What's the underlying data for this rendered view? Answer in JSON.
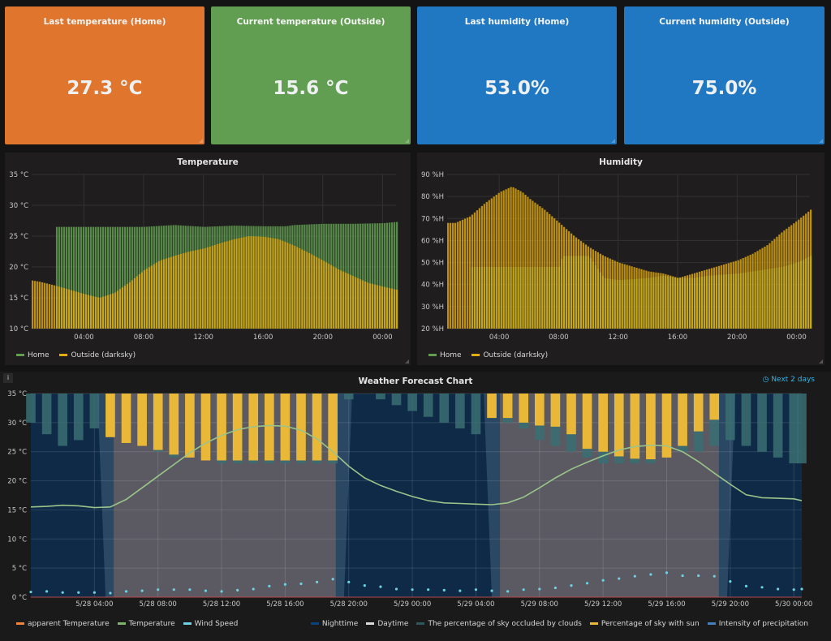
{
  "stats": [
    {
      "title": "Last temperature (Home)",
      "value": "27.3 °C",
      "color": "#e0752d"
    },
    {
      "title": "Current temperature (Outside)",
      "value": "15.6 °C",
      "color": "#629e51"
    },
    {
      "title": "Last humidity (Home)",
      "value": "53.0%",
      "color": "#1f78c1"
    },
    {
      "title": "Current humidity (Outside)",
      "value": "75.0%",
      "color": "#1f78c1"
    }
  ],
  "temperature_panel": {
    "title": "Temperature",
    "legend": [
      {
        "label": "Home",
        "color": "#629e51"
      },
      {
        "label": "Outside (darksky)",
        "color": "#e5ac0e"
      }
    ]
  },
  "humidity_panel": {
    "title": "Humidity",
    "legend": [
      {
        "label": "Home",
        "color": "#629e51"
      },
      {
        "label": "Outside (darksky)",
        "color": "#e5ac0e"
      }
    ]
  },
  "forecast_panel": {
    "title": "Weather Forecast Chart",
    "time_range": "Next 2 days",
    "legend_left": [
      {
        "label": "apparent Temperature",
        "color": "#ef843c"
      },
      {
        "label": "Temperature",
        "color": "#7eb26d"
      },
      {
        "label": "Wind Speed",
        "color": "#6ed0e0"
      }
    ],
    "legend_right": [
      {
        "label": "Nighttime",
        "color": "#0a437c"
      },
      {
        "label": "Daytime",
        "color": "#d8d9da"
      },
      {
        "label": "The percentage of sky occluded by clouds",
        "color": "#2f575e"
      },
      {
        "label": "Percentage of sky with sun",
        "color": "#eab839"
      },
      {
        "label": "Intensity of precipitation",
        "color": "#447ebc"
      }
    ]
  },
  "chart_data": [
    {
      "type": "bar",
      "title": "Temperature",
      "yunit": "°C",
      "ylim": [
        10,
        35
      ],
      "yticks": [
        "10 °C",
        "15 °C",
        "20 °C",
        "25 °C",
        "30 °C",
        "35 °C"
      ],
      "xticks": [
        "04:00",
        "08:00",
        "12:00",
        "16:00",
        "20:00",
        "00:00"
      ],
      "x_hours": [
        4,
        8,
        12,
        16,
        20,
        24
      ],
      "x_range_hours": [
        0.5,
        24.9
      ],
      "series": [
        {
          "name": "Home",
          "color": "#629e51",
          "points": [
            [
              0.5,
              null
            ],
            [
              2,
              null
            ],
            [
              2.1,
              26.5
            ],
            [
              4,
              26.5
            ],
            [
              8,
              26.5
            ],
            [
              10,
              26.8
            ],
            [
              12,
              26.5
            ],
            [
              14,
              26.7
            ],
            [
              16,
              26.6
            ],
            [
              17.5,
              26.6
            ],
            [
              18,
              26.8
            ],
            [
              20,
              27
            ],
            [
              22,
              27
            ],
            [
              24,
              27.1
            ],
            [
              24.9,
              27.3
            ]
          ]
        },
        {
          "name": "Outside (darksky)",
          "color": "#e5ac0e",
          "points": [
            [
              0.5,
              17.8
            ],
            [
              1,
              17.6
            ],
            [
              2,
              17
            ],
            [
              3,
              16.3
            ],
            [
              4,
              15.6
            ],
            [
              5,
              15
            ],
            [
              6,
              15.8
            ],
            [
              7,
              17.5
            ],
            [
              8,
              19.5
            ],
            [
              9,
              21
            ],
            [
              10,
              21.8
            ],
            [
              11,
              22.5
            ],
            [
              12,
              23
            ],
            [
              13,
              23.8
            ],
            [
              14,
              24.5
            ],
            [
              15,
              25
            ],
            [
              16,
              24.9
            ],
            [
              17,
              24.5
            ],
            [
              18,
              23.5
            ],
            [
              19,
              22.3
            ],
            [
              20,
              21
            ],
            [
              21,
              19.6
            ],
            [
              22,
              18.5
            ],
            [
              23,
              17.4
            ],
            [
              24,
              16.8
            ],
            [
              24.9,
              16.3
            ]
          ]
        }
      ]
    },
    {
      "type": "bar",
      "title": "Humidity",
      "yunit": "%H",
      "ylim": [
        20,
        90
      ],
      "yticks": [
        "20 %H",
        "30 %H",
        "40 %H",
        "50 %H",
        "60 %H",
        "70 %H",
        "80 %H",
        "90 %H"
      ],
      "xticks": [
        "04:00",
        "08:00",
        "12:00",
        "16:00",
        "20:00",
        "00:00"
      ],
      "x_hours": [
        4,
        8,
        12,
        16,
        20,
        24
      ],
      "x_range_hours": [
        0.5,
        24.9
      ],
      "series": [
        {
          "name": "Home",
          "color": "#629e51",
          "points": [
            [
              0.5,
              null
            ],
            [
              2,
              null
            ],
            [
              2.1,
              48
            ],
            [
              8,
              48
            ],
            [
              8.2,
              53
            ],
            [
              10,
              53
            ],
            [
              10.5,
              48
            ],
            [
              11,
              43
            ],
            [
              12,
              42
            ],
            [
              14,
              43
            ],
            [
              15,
              44
            ],
            [
              16,
              43
            ],
            [
              17,
              43
            ],
            [
              18,
              44
            ],
            [
              20,
              45
            ],
            [
              21,
              46
            ],
            [
              22,
              47
            ],
            [
              23,
              48
            ],
            [
              24,
              50
            ],
            [
              24.9,
              53
            ]
          ]
        },
        {
          "name": "Outside (darksky)",
          "color": "#e5ac0e",
          "points": [
            [
              0.5,
              68
            ],
            [
              1,
              68
            ],
            [
              2,
              71
            ],
            [
              3,
              77
            ],
            [
              4,
              82
            ],
            [
              4.8,
              84.5
            ],
            [
              5.5,
              82
            ],
            [
              6,
              79
            ],
            [
              7,
              74
            ],
            [
              8,
              68
            ],
            [
              9,
              62
            ],
            [
              10,
              57
            ],
            [
              11,
              53
            ],
            [
              12,
              50
            ],
            [
              13,
              48
            ],
            [
              14,
              46
            ],
            [
              15,
              45
            ],
            [
              16,
              43
            ],
            [
              17,
              45
            ],
            [
              18,
              47
            ],
            [
              19,
              49
            ],
            [
              20,
              51
            ],
            [
              21,
              54
            ],
            [
              22,
              58
            ],
            [
              23,
              64
            ],
            [
              24,
              69
            ],
            [
              24.9,
              74
            ]
          ]
        }
      ]
    },
    {
      "type": "line",
      "title": "Weather Forecast Chart",
      "ylim": [
        0,
        35
      ],
      "yticks": [
        "0 °C",
        "5 °C",
        "10 °C",
        "15 °C",
        "20 °C",
        "25 °C",
        "30 °C",
        "35 °C"
      ],
      "xticks": [
        "5/28 04:00",
        "5/28 08:00",
        "5/28 12:00",
        "5/28 16:00",
        "5/28 20:00",
        "5/29 00:00",
        "5/29 04:00",
        "5/29 08:00",
        "5/29 12:00",
        "5/29 16:00",
        "5/29 20:00",
        "5/30 00:00"
      ],
      "x_hours": [
        4,
        8,
        12,
        16,
        20,
        24,
        28,
        32,
        36,
        40,
        44,
        48
      ],
      "x_range_hours": [
        0,
        48.5
      ],
      "daytime_hours": [
        [
          4.7,
          19.7
        ],
        [
          29,
          43.8
        ]
      ],
      "temperature": [
        [
          0,
          15.5
        ],
        [
          1,
          15.6
        ],
        [
          2,
          15.8
        ],
        [
          3,
          15.7
        ],
        [
          4,
          15.4
        ],
        [
          5,
          15.5
        ],
        [
          6,
          16.8
        ],
        [
          7,
          18.8
        ],
        [
          8,
          20.8
        ],
        [
          9,
          22.8
        ],
        [
          10,
          24.8
        ],
        [
          11,
          26.5
        ],
        [
          12,
          27.8
        ],
        [
          13,
          28.8
        ],
        [
          14,
          29.3
        ],
        [
          15,
          29.5
        ],
        [
          16,
          29.4
        ],
        [
          17,
          28.7
        ],
        [
          18,
          27.2
        ],
        [
          19,
          25
        ],
        [
          20,
          22.5
        ],
        [
          21,
          20.5
        ],
        [
          22,
          19.2
        ],
        [
          23,
          18.2
        ],
        [
          24,
          17.3
        ],
        [
          25,
          16.6
        ],
        [
          26,
          16.2
        ],
        [
          27,
          16.1
        ],
        [
          28,
          16
        ],
        [
          29,
          15.9
        ],
        [
          30,
          16.2
        ],
        [
          31,
          17.2
        ],
        [
          32,
          18.8
        ],
        [
          33,
          20.5
        ],
        [
          34,
          22
        ],
        [
          35,
          23.2
        ],
        [
          36,
          24.3
        ],
        [
          37,
          25.3
        ],
        [
          38,
          25.9
        ],
        [
          39,
          26.1
        ],
        [
          40,
          26
        ],
        [
          41,
          25
        ],
        [
          42,
          23.3
        ],
        [
          43,
          21.3
        ],
        [
          44,
          19.4
        ],
        [
          45,
          17.6
        ],
        [
          46,
          17.1
        ],
        [
          47,
          17
        ],
        [
          48,
          16.9
        ],
        [
          48.5,
          16.6
        ]
      ],
      "wind_speed": [
        [
          0,
          0.9
        ],
        [
          1,
          1.0
        ],
        [
          2,
          0.8
        ],
        [
          3,
          0.8
        ],
        [
          4,
          0.8
        ],
        [
          5,
          0.7
        ],
        [
          6,
          1.0
        ],
        [
          7,
          1.1
        ],
        [
          8,
          1.3
        ],
        [
          9,
          1.3
        ],
        [
          10,
          1.3
        ],
        [
          11,
          1.1
        ],
        [
          12,
          1.0
        ],
        [
          13,
          1.2
        ],
        [
          14,
          1.4
        ],
        [
          15,
          1.9
        ],
        [
          16,
          2.2
        ],
        [
          17,
          2.3
        ],
        [
          18,
          2.6
        ],
        [
          19,
          3.1
        ],
        [
          20,
          2.6
        ],
        [
          21,
          2.0
        ],
        [
          22,
          1.8
        ],
        [
          23,
          1.4
        ],
        [
          24,
          1.3
        ],
        [
          25,
          1.3
        ],
        [
          26,
          1.2
        ],
        [
          27,
          1.1
        ],
        [
          28,
          1.3
        ],
        [
          29,
          1.1
        ],
        [
          30,
          1.0
        ],
        [
          31,
          1.3
        ],
        [
          32,
          1.4
        ],
        [
          33,
          1.6
        ],
        [
          34,
          2.0
        ],
        [
          35,
          2.4
        ],
        [
          36,
          2.9
        ],
        [
          37,
          3.2
        ],
        [
          38,
          3.6
        ],
        [
          39,
          3.9
        ],
        [
          40,
          4.2
        ],
        [
          41,
          3.7
        ],
        [
          42,
          3.7
        ],
        [
          43,
          3.6
        ],
        [
          44,
          2.7
        ],
        [
          45,
          1.9
        ],
        [
          46,
          1.7
        ],
        [
          47,
          1.4
        ],
        [
          48,
          1.3
        ],
        [
          48.5,
          1.4
        ]
      ],
      "cloud_pct": [
        [
          0,
          30
        ],
        [
          1,
          28
        ],
        [
          2,
          26
        ],
        [
          3,
          27
        ],
        [
          4,
          29
        ],
        [
          5,
          28
        ],
        [
          6,
          27
        ],
        [
          7,
          26
        ],
        [
          8,
          25
        ],
        [
          9,
          24
        ],
        [
          10,
          24
        ],
        [
          11,
          24
        ],
        [
          12,
          23
        ],
        [
          13,
          23
        ],
        [
          14,
          23
        ],
        [
          15,
          23
        ],
        [
          16,
          23
        ],
        [
          17,
          23
        ],
        [
          18,
          23
        ],
        [
          19,
          23
        ],
        [
          20,
          34
        ],
        [
          21,
          35
        ],
        [
          22,
          34
        ],
        [
          23,
          33
        ],
        [
          24,
          32
        ],
        [
          25,
          31
        ],
        [
          26,
          30
        ],
        [
          27,
          29
        ],
        [
          28,
          28
        ],
        [
          29,
          31
        ],
        [
          30,
          30
        ],
        [
          31,
          29
        ],
        [
          32,
          27
        ],
        [
          33,
          26
        ],
        [
          34,
          25
        ],
        [
          35,
          24
        ],
        [
          36,
          23
        ],
        [
          37,
          23
        ],
        [
          38,
          23
        ],
        [
          39,
          23
        ],
        [
          40,
          24
        ],
        [
          41,
          25
        ],
        [
          42,
          25
        ],
        [
          43,
          26
        ],
        [
          44,
          27
        ],
        [
          45,
          26
        ],
        [
          46,
          25
        ],
        [
          47,
          24
        ],
        [
          48,
          23
        ],
        [
          48.5,
          23
        ]
      ],
      "sun_pct": [
        [
          5,
          27.5
        ],
        [
          6,
          26.5
        ],
        [
          7,
          26
        ],
        [
          8,
          25.3
        ],
        [
          9,
          24.5
        ],
        [
          10,
          24
        ],
        [
          11,
          23.5
        ],
        [
          12,
          23.5
        ],
        [
          13,
          23.5
        ],
        [
          14,
          23.5
        ],
        [
          15,
          23.5
        ],
        [
          16,
          23.5
        ],
        [
          17,
          23.5
        ],
        [
          18,
          23.5
        ],
        [
          19,
          23.5
        ],
        [
          29,
          30.8
        ],
        [
          30,
          30.8
        ],
        [
          31,
          30
        ],
        [
          32,
          29.5
        ],
        [
          33,
          29.3
        ],
        [
          34,
          28
        ],
        [
          35,
          25.5
        ],
        [
          36,
          25
        ],
        [
          37,
          24.2
        ],
        [
          38,
          23.8
        ],
        [
          39,
          23.7
        ],
        [
          40,
          24
        ],
        [
          41,
          26
        ],
        [
          42,
          28.5
        ],
        [
          43,
          30.5
        ]
      ]
    }
  ]
}
